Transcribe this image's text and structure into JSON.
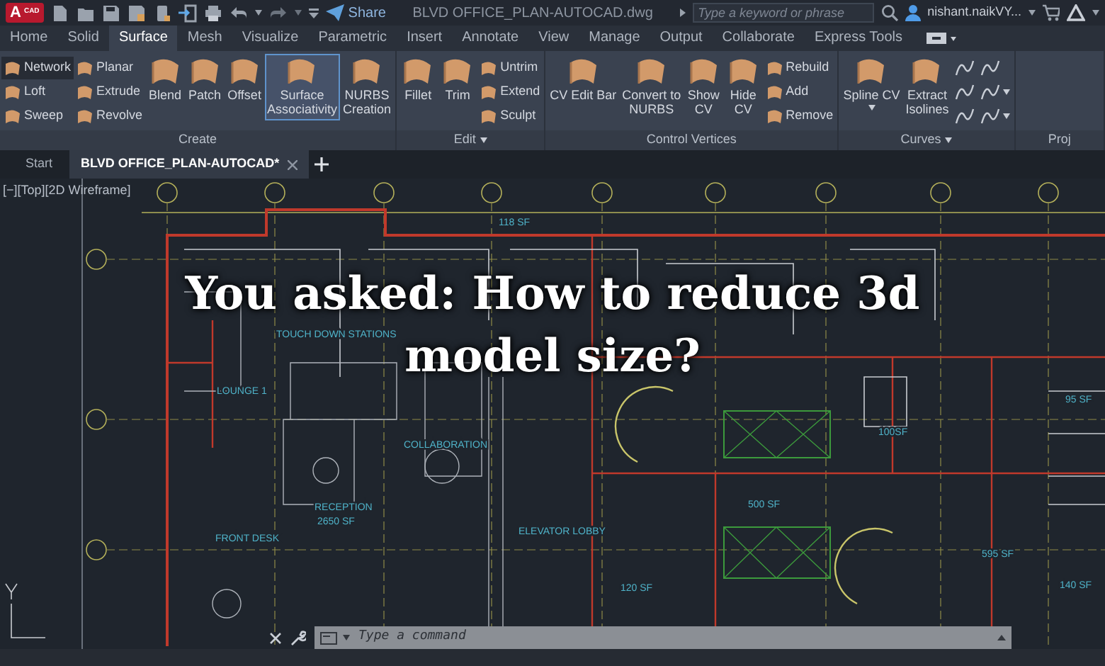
{
  "title_bar": {
    "logo_letter": "A",
    "logo_sub": "CAD",
    "share_label": "Share",
    "document_title": "BLVD OFFICE_PLAN-AUTOCAD.dwg",
    "search": {
      "placeholder": "Type a keyword or phrase"
    },
    "user": "nishant.naikVY..."
  },
  "ribbon_tabs": [
    {
      "label": "Home",
      "selected": false
    },
    {
      "label": "Solid",
      "selected": false
    },
    {
      "label": "Surface",
      "selected": true
    },
    {
      "label": "Mesh",
      "selected": false
    },
    {
      "label": "Visualize",
      "selected": false
    },
    {
      "label": "Parametric",
      "selected": false
    },
    {
      "label": "Insert",
      "selected": false
    },
    {
      "label": "Annotate",
      "selected": false
    },
    {
      "label": "View",
      "selected": false
    },
    {
      "label": "Manage",
      "selected": false
    },
    {
      "label": "Output",
      "selected": false
    },
    {
      "label": "Collaborate",
      "selected": false
    },
    {
      "label": "Express Tools",
      "selected": false
    }
  ],
  "ribbon_panels": [
    {
      "title": "Create",
      "menu": false,
      "tools": [
        {
          "kind": "small",
          "label": "Network",
          "active": true,
          "menu": false
        },
        {
          "kind": "small",
          "label": "Loft",
          "active": false,
          "menu": false
        },
        {
          "kind": "small",
          "label": "Sweep",
          "active": false,
          "menu": false
        },
        {
          "kind": "small",
          "label": "Planar",
          "active": false,
          "menu": false
        },
        {
          "kind": "small",
          "label": "Extrude",
          "active": false,
          "menu": false
        },
        {
          "kind": "small",
          "label": "Revolve",
          "active": false,
          "menu": false
        },
        {
          "kind": "large",
          "label": "Blend",
          "active": false,
          "menu": false
        },
        {
          "kind": "large",
          "label": "Patch",
          "active": false,
          "menu": false
        },
        {
          "kind": "large",
          "label": "Offset",
          "active": false,
          "menu": false
        },
        {
          "kind": "large",
          "label": "Surface\nAssociativity",
          "active": true,
          "menu": false
        },
        {
          "kind": "large",
          "label": "NURBS\nCreation",
          "active": false,
          "menu": false
        }
      ]
    },
    {
      "title": "Edit",
      "menu": true,
      "tools": [
        {
          "kind": "large",
          "label": "Fillet",
          "active": false,
          "menu": false
        },
        {
          "kind": "large",
          "label": "Trim",
          "active": false,
          "menu": false
        },
        {
          "kind": "small",
          "label": "Untrim",
          "active": false,
          "menu": false
        },
        {
          "kind": "small",
          "label": "Extend",
          "active": false,
          "menu": false
        },
        {
          "kind": "small",
          "label": "Sculpt",
          "active": false,
          "menu": false
        }
      ]
    },
    {
      "title": "Control Vertices",
      "menu": false,
      "tools": [
        {
          "kind": "large",
          "label": "CV Edit Bar",
          "active": false,
          "menu": false
        },
        {
          "kind": "large",
          "label": "Convert to\nNURBS",
          "active": false,
          "menu": false
        },
        {
          "kind": "large",
          "label": "Show\nCV",
          "active": false,
          "menu": false
        },
        {
          "kind": "large",
          "label": "Hide\nCV",
          "active": false,
          "menu": false
        },
        {
          "kind": "small",
          "label": "Rebuild",
          "active": false,
          "menu": false
        },
        {
          "kind": "small",
          "label": "Add",
          "active": false,
          "menu": false
        },
        {
          "kind": "small",
          "label": "Remove",
          "active": false,
          "menu": false
        }
      ]
    },
    {
      "title": "Curves",
      "menu": true,
      "tools": [
        {
          "kind": "large",
          "label": "Spline CV",
          "active": false,
          "menu": true
        },
        {
          "kind": "large",
          "label": "Extract\nIsolines",
          "active": false,
          "menu": false
        },
        {
          "kind": "icon",
          "active": false,
          "menu": false
        },
        {
          "kind": "icon",
          "active": false,
          "menu": false
        },
        {
          "kind": "icon",
          "active": false,
          "menu": false
        },
        {
          "kind": "icon",
          "active": false,
          "menu": false
        },
        {
          "kind": "icon",
          "active": false,
          "menu": true
        },
        {
          "kind": "icon",
          "active": false,
          "menu": true
        }
      ]
    },
    {
      "title": "Proj",
      "menu": false
    }
  ],
  "file_tabs": [
    {
      "label": "Start",
      "selected": false,
      "closable": false
    },
    {
      "label": "BLVD OFFICE_PLAN-AUTOCAD*",
      "selected": true,
      "closable": true
    }
  ],
  "viewport": {
    "controls": "[−][Top][2D Wireframe]",
    "caption_lines": [
      "You asked: How to reduce 3d",
      "model size?"
    ],
    "room_labels": [
      "118 SF",
      "TOUCH DOWN STATIONS",
      "LOUNGE 1",
      "COLLABORATION",
      "RECEPTION",
      "2650 SF",
      "FRONT DESK",
      "ELEVATOR LOBBY",
      "500 SF",
      "100SF",
      "95 SF",
      "595 SF",
      "120 SF",
      "140 SF"
    ]
  },
  "command_line": {
    "placeholder": "Type a command"
  }
}
